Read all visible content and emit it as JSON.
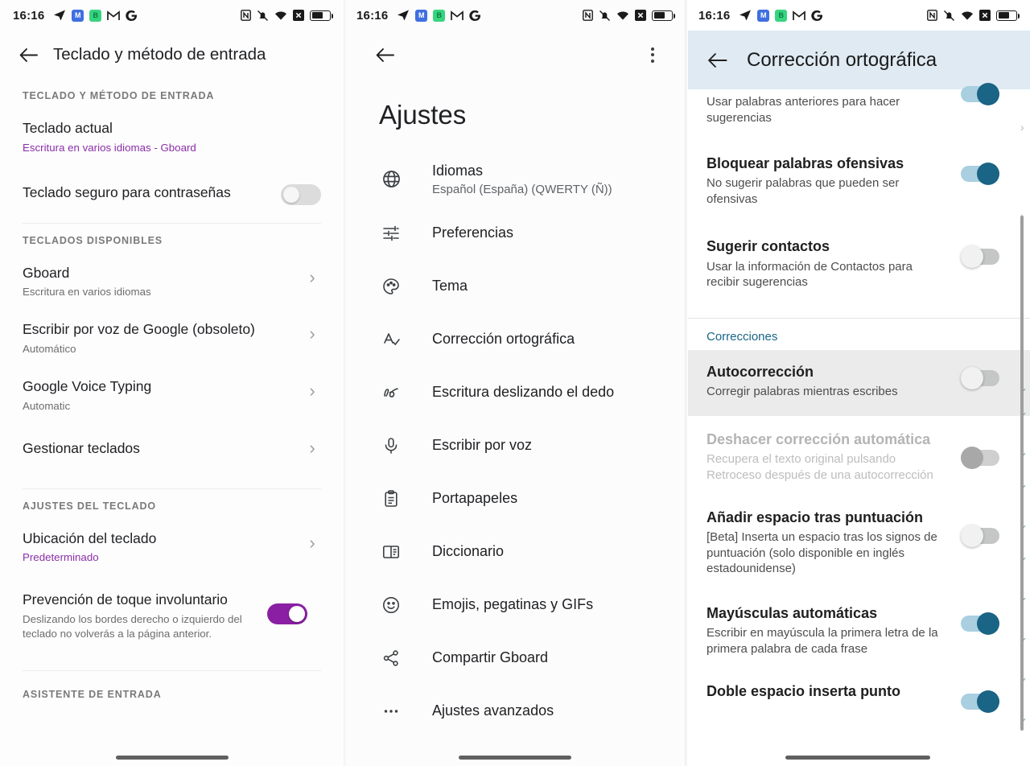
{
  "status_bar": {
    "time": "16:16",
    "left_icons": [
      "telegram-icon",
      "app-blue-icon",
      "app-green-icon",
      "gmail-icon",
      "google-icon"
    ],
    "right_icons": [
      "nfc-icon",
      "mute-bell-icon",
      "wifi-icon",
      "x-box-icon",
      "battery-icon"
    ],
    "badge_blue_text": "M",
    "badge_green_text": "B"
  },
  "panel1": {
    "app_bar": {
      "back": "back-arrow",
      "title": "Teclado y método de entrada"
    },
    "sections": [
      {
        "header": "TECLADO Y MÉTODO DE ENTRADA",
        "rows": [
          {
            "title": "Teclado actual",
            "subtitle": "Escritura en varios idiomas - Gboard",
            "subtitle_style": "purple",
            "control": "none"
          },
          {
            "title": "Teclado seguro para contraseñas",
            "subtitle": "",
            "control": "toggle-off"
          }
        ]
      },
      {
        "header": "TECLADOS DISPONIBLES",
        "rows": [
          {
            "title": "Gboard",
            "subtitle": "Escritura en varios idiomas",
            "control": "chevron"
          },
          {
            "title": "Escribir por voz de Google (obsoleto)",
            "subtitle": "Automático",
            "control": "chevron"
          },
          {
            "title": "Google Voice Typing",
            "subtitle": "Automatic",
            "control": "chevron"
          },
          {
            "title": "Gestionar teclados",
            "subtitle": "",
            "control": "chevron"
          }
        ]
      },
      {
        "header": "AJUSTES DEL TECLADO",
        "rows": [
          {
            "title": "Ubicación del teclado",
            "subtitle": "Predeterminado",
            "subtitle_style": "purple",
            "control": "chevron"
          },
          {
            "title": "Prevención de toque involuntario",
            "subtitle": "Deslizando los bordes derecho o izquierdo del teclado no volverás a la página anterior.",
            "control": "toggle-on-purple"
          }
        ]
      },
      {
        "header": "ASISTENTE DE ENTRADA",
        "rows": []
      }
    ]
  },
  "panel2": {
    "app_bar": {
      "back": "back-arrow",
      "overflow": "kebab-menu"
    },
    "title": "Ajustes",
    "items": [
      {
        "icon": "globe-icon",
        "label": "Idiomas",
        "subtitle": "Español (España) (QWERTY (Ñ))"
      },
      {
        "icon": "sliders-icon",
        "label": "Preferencias",
        "subtitle": ""
      },
      {
        "icon": "palette-icon",
        "label": "Tema",
        "subtitle": ""
      },
      {
        "icon": "spellcheck-icon",
        "label": "Corrección ortográfica",
        "subtitle": ""
      },
      {
        "icon": "glide-typing-icon",
        "label": "Escritura deslizando el dedo",
        "subtitle": ""
      },
      {
        "icon": "microphone-icon",
        "label": "Escribir por voz",
        "subtitle": ""
      },
      {
        "icon": "clipboard-icon",
        "label": "Portapapeles",
        "subtitle": ""
      },
      {
        "icon": "dictionary-icon",
        "label": "Diccionario",
        "subtitle": ""
      },
      {
        "icon": "emoji-icon",
        "label": "Emojis, pegatinas y GIFs",
        "subtitle": ""
      },
      {
        "icon": "share-icon",
        "label": "Compartir Gboard",
        "subtitle": ""
      },
      {
        "icon": "more-horizontal-icon",
        "label": "Ajustes avanzados",
        "subtitle": ""
      }
    ]
  },
  "panel3": {
    "app_bar": {
      "back": "back-arrow",
      "title": "Corrección ortográfica"
    },
    "header_bg": "#dfeaf2",
    "rows": [
      {
        "title": "",
        "subtitle": "Usar palabras anteriores para hacer sugerencias",
        "control": "toggle-on",
        "partial": true
      },
      {
        "title": "Bloquear palabras ofensivas",
        "subtitle": "No sugerir palabras que pueden ser ofensivas",
        "control": "toggle-on"
      },
      {
        "title": "Sugerir contactos",
        "subtitle": "Usar la información de Contactos para recibir sugerencias",
        "control": "toggle-off"
      }
    ],
    "category": "Correcciones",
    "rows2": [
      {
        "title": "Autocorrección",
        "subtitle": "Corregir palabras mientras escribes",
        "control": "toggle-off",
        "highlighted": true
      },
      {
        "title": "Deshacer corrección automática",
        "subtitle": "Recupera el texto original pulsando Retroceso después de una autocorrección",
        "control": "toggle-disabled",
        "disabled": true
      },
      {
        "title": "Añadir espacio tras puntuación",
        "subtitle": "[Beta] Inserta un espacio tras los signos de puntuación (solo disponible en inglés estadounidense)",
        "control": "toggle-off"
      },
      {
        "title": "Mayúsculas automáticas",
        "subtitle": "Escribir en mayúscula la primera letra de la primera palabra de cada frase",
        "control": "toggle-on"
      },
      {
        "title": "Doble espacio inserta punto",
        "subtitle": "",
        "control": "toggle-on"
      }
    ],
    "accent_color": "#1a6485"
  }
}
